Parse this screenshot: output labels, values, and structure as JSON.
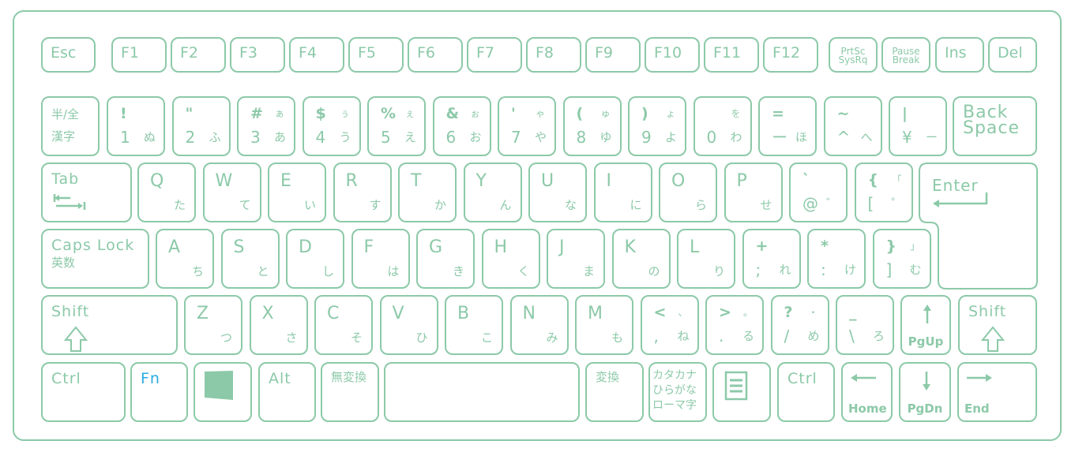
{
  "colors": {
    "key_outline": "#8cc9a8",
    "fn_label": "#29abe2",
    "background": "#ffffff"
  },
  "function_row": [
    {
      "l1": "Esc"
    },
    {
      "l1": "F1"
    },
    {
      "l1": "F2"
    },
    {
      "l1": "F3"
    },
    {
      "l1": "F4"
    },
    {
      "l1": "F5"
    },
    {
      "l1": "F6"
    },
    {
      "l1": "F7"
    },
    {
      "l1": "F8"
    },
    {
      "l1": "F9"
    },
    {
      "l1": "F10"
    },
    {
      "l1": "F11"
    },
    {
      "l1": "F12"
    },
    {
      "s1": "PrtSc",
      "s2": "SysRq"
    },
    {
      "s1": "Pause",
      "s2": "Break"
    },
    {
      "l1": "Ins"
    },
    {
      "l1": "Del"
    }
  ],
  "number_row": [
    {
      "l1": "半/全",
      "l2": "漢字"
    },
    {
      "tl": "!",
      "bl": "1",
      "br": "ぬ"
    },
    {
      "tl": "\"",
      "bl": "2",
      "br": "ふ"
    },
    {
      "tl": "#",
      "tr": "ぁ",
      "bl": "3",
      "br": "あ"
    },
    {
      "tl": "$",
      "tr": "ぅ",
      "bl": "4",
      "br": "う"
    },
    {
      "tl": "%",
      "tr": "ぇ",
      "bl": "5",
      "br": "え"
    },
    {
      "tl": "&",
      "tr": "ぉ",
      "bl": "6",
      "br": "お"
    },
    {
      "tl": "'",
      "tr": "ゃ",
      "bl": "7",
      "br": "や"
    },
    {
      "tl": "(",
      "tr": "ゅ",
      "bl": "8",
      "br": "ゆ"
    },
    {
      "tl": ")",
      "tr": "ょ",
      "bl": "9",
      "br": "よ"
    },
    {
      "tr": "を",
      "bl": "0",
      "br": "わ"
    },
    {
      "tl": "=",
      "bl": "ー",
      "br": "ほ"
    },
    {
      "tl": "~",
      "bl": "^",
      "br": "へ"
    },
    {
      "tl": "|",
      "bl": "¥",
      "br": "ー"
    },
    {
      "l1": "Back",
      "l2": "Space"
    }
  ],
  "qwerty_row": [
    {
      "l1": "Tab",
      "icon": "tab-arrows"
    },
    {
      "tl": "Q",
      "br": "た"
    },
    {
      "tl": "W",
      "br": "て"
    },
    {
      "tl": "E",
      "br": "い"
    },
    {
      "tl": "R",
      "br": "す"
    },
    {
      "tl": "T",
      "br": "か"
    },
    {
      "tl": "Y",
      "br": "ん"
    },
    {
      "tl": "U",
      "br": "な"
    },
    {
      "tl": "I",
      "br": "に"
    },
    {
      "tl": "O",
      "br": "ら"
    },
    {
      "tl": "P",
      "br": "せ"
    },
    {
      "tl": "`",
      "bl": "@",
      "br": "゛"
    },
    {
      "tl": "{",
      "tr": "「",
      "bl": "[",
      "br": "゜"
    }
  ],
  "enter_key": {
    "l1": "Enter",
    "icon": "enter-arrow"
  },
  "home_row": [
    {
      "l1": "Caps Lock",
      "l2": "英数"
    },
    {
      "tl": "A",
      "br": "ち"
    },
    {
      "tl": "S",
      "br": "と"
    },
    {
      "tl": "D",
      "br": "し"
    },
    {
      "tl": "F",
      "br": "は"
    },
    {
      "tl": "G",
      "br": "き"
    },
    {
      "tl": "H",
      "br": "く"
    },
    {
      "tl": "J",
      "br": "ま"
    },
    {
      "tl": "K",
      "br": "の"
    },
    {
      "tl": "L",
      "br": "り"
    },
    {
      "tl": "+",
      "bl": ";",
      "br": "れ"
    },
    {
      "tl": "*",
      "bl": ":",
      "br": "け"
    },
    {
      "tl": "}",
      "tr": "」",
      "bl": "]",
      "br": "む"
    }
  ],
  "shift_row": [
    {
      "l1": "Shift",
      "icon": "shift-arrow"
    },
    {
      "tl": "Z",
      "br": "つ"
    },
    {
      "tl": "X",
      "br": "さ"
    },
    {
      "tl": "C",
      "br": "そ"
    },
    {
      "tl": "V",
      "br": "ひ"
    },
    {
      "tl": "B",
      "br": "こ"
    },
    {
      "tl": "N",
      "br": "み"
    },
    {
      "tl": "M",
      "br": "も"
    },
    {
      "tl": "<",
      "tr": "、",
      "bl": ",",
      "br": "ね"
    },
    {
      "tl": ">",
      "tr": "。",
      "bl": ".",
      "br": "る"
    },
    {
      "tl": "?",
      "tr": "・",
      "bl": "/",
      "br": "め"
    },
    {
      "tl": "_",
      "bl": "\\",
      "br": "ろ"
    },
    {
      "nav": "PgUp",
      "icon": "arrow-up"
    },
    {
      "l1": "Shift",
      "icon": "shift-arrow"
    }
  ],
  "bottom_row": [
    {
      "l1": "Ctrl"
    },
    {
      "l1": "Fn"
    },
    {
      "icon": "windows-logo"
    },
    {
      "l1": "Alt"
    },
    {
      "l1": "無変換"
    },
    {},
    {
      "l1": "変換"
    },
    {
      "s1": "カタカナ",
      "s2": "ひらがな",
      "s3": "ローマ字"
    },
    {
      "icon": "menu"
    },
    {
      "l1": "Ctrl"
    },
    {
      "nav": "Home",
      "icon": "arrow-left"
    },
    {
      "nav": "PgDn",
      "icon": "arrow-down"
    },
    {
      "nav": "End",
      "icon": "arrow-right"
    }
  ]
}
